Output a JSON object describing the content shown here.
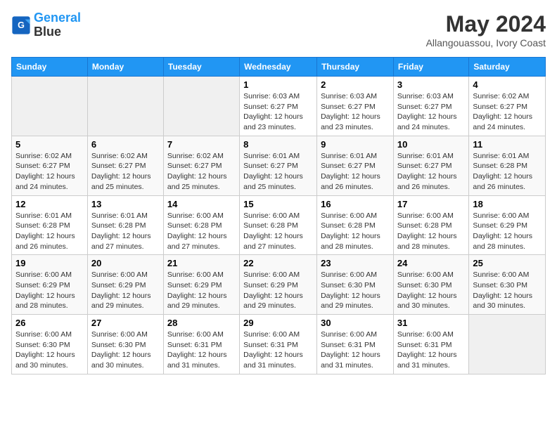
{
  "header": {
    "logo_line1": "General",
    "logo_line2": "Blue",
    "month_year": "May 2024",
    "location": "Allangouassou, Ivory Coast"
  },
  "days_of_week": [
    "Sunday",
    "Monday",
    "Tuesday",
    "Wednesday",
    "Thursday",
    "Friday",
    "Saturday"
  ],
  "weeks": [
    [
      {
        "day": "",
        "info": ""
      },
      {
        "day": "",
        "info": ""
      },
      {
        "day": "",
        "info": ""
      },
      {
        "day": "1",
        "info": "Sunrise: 6:03 AM\nSunset: 6:27 PM\nDaylight: 12 hours\nand 23 minutes."
      },
      {
        "day": "2",
        "info": "Sunrise: 6:03 AM\nSunset: 6:27 PM\nDaylight: 12 hours\nand 23 minutes."
      },
      {
        "day": "3",
        "info": "Sunrise: 6:03 AM\nSunset: 6:27 PM\nDaylight: 12 hours\nand 24 minutes."
      },
      {
        "day": "4",
        "info": "Sunrise: 6:02 AM\nSunset: 6:27 PM\nDaylight: 12 hours\nand 24 minutes."
      }
    ],
    [
      {
        "day": "5",
        "info": "Sunrise: 6:02 AM\nSunset: 6:27 PM\nDaylight: 12 hours\nand 24 minutes."
      },
      {
        "day": "6",
        "info": "Sunrise: 6:02 AM\nSunset: 6:27 PM\nDaylight: 12 hours\nand 25 minutes."
      },
      {
        "day": "7",
        "info": "Sunrise: 6:02 AM\nSunset: 6:27 PM\nDaylight: 12 hours\nand 25 minutes."
      },
      {
        "day": "8",
        "info": "Sunrise: 6:01 AM\nSunset: 6:27 PM\nDaylight: 12 hours\nand 25 minutes."
      },
      {
        "day": "9",
        "info": "Sunrise: 6:01 AM\nSunset: 6:27 PM\nDaylight: 12 hours\nand 26 minutes."
      },
      {
        "day": "10",
        "info": "Sunrise: 6:01 AM\nSunset: 6:27 PM\nDaylight: 12 hours\nand 26 minutes."
      },
      {
        "day": "11",
        "info": "Sunrise: 6:01 AM\nSunset: 6:28 PM\nDaylight: 12 hours\nand 26 minutes."
      }
    ],
    [
      {
        "day": "12",
        "info": "Sunrise: 6:01 AM\nSunset: 6:28 PM\nDaylight: 12 hours\nand 26 minutes."
      },
      {
        "day": "13",
        "info": "Sunrise: 6:01 AM\nSunset: 6:28 PM\nDaylight: 12 hours\nand 27 minutes."
      },
      {
        "day": "14",
        "info": "Sunrise: 6:00 AM\nSunset: 6:28 PM\nDaylight: 12 hours\nand 27 minutes."
      },
      {
        "day": "15",
        "info": "Sunrise: 6:00 AM\nSunset: 6:28 PM\nDaylight: 12 hours\nand 27 minutes."
      },
      {
        "day": "16",
        "info": "Sunrise: 6:00 AM\nSunset: 6:28 PM\nDaylight: 12 hours\nand 28 minutes."
      },
      {
        "day": "17",
        "info": "Sunrise: 6:00 AM\nSunset: 6:28 PM\nDaylight: 12 hours\nand 28 minutes."
      },
      {
        "day": "18",
        "info": "Sunrise: 6:00 AM\nSunset: 6:29 PM\nDaylight: 12 hours\nand 28 minutes."
      }
    ],
    [
      {
        "day": "19",
        "info": "Sunrise: 6:00 AM\nSunset: 6:29 PM\nDaylight: 12 hours\nand 28 minutes."
      },
      {
        "day": "20",
        "info": "Sunrise: 6:00 AM\nSunset: 6:29 PM\nDaylight: 12 hours\nand 29 minutes."
      },
      {
        "day": "21",
        "info": "Sunrise: 6:00 AM\nSunset: 6:29 PM\nDaylight: 12 hours\nand 29 minutes."
      },
      {
        "day": "22",
        "info": "Sunrise: 6:00 AM\nSunset: 6:29 PM\nDaylight: 12 hours\nand 29 minutes."
      },
      {
        "day": "23",
        "info": "Sunrise: 6:00 AM\nSunset: 6:30 PM\nDaylight: 12 hours\nand 29 minutes."
      },
      {
        "day": "24",
        "info": "Sunrise: 6:00 AM\nSunset: 6:30 PM\nDaylight: 12 hours\nand 30 minutes."
      },
      {
        "day": "25",
        "info": "Sunrise: 6:00 AM\nSunset: 6:30 PM\nDaylight: 12 hours\nand 30 minutes."
      }
    ],
    [
      {
        "day": "26",
        "info": "Sunrise: 6:00 AM\nSunset: 6:30 PM\nDaylight: 12 hours\nand 30 minutes."
      },
      {
        "day": "27",
        "info": "Sunrise: 6:00 AM\nSunset: 6:30 PM\nDaylight: 12 hours\nand 30 minutes."
      },
      {
        "day": "28",
        "info": "Sunrise: 6:00 AM\nSunset: 6:31 PM\nDaylight: 12 hours\nand 31 minutes."
      },
      {
        "day": "29",
        "info": "Sunrise: 6:00 AM\nSunset: 6:31 PM\nDaylight: 12 hours\nand 31 minutes."
      },
      {
        "day": "30",
        "info": "Sunrise: 6:00 AM\nSunset: 6:31 PM\nDaylight: 12 hours\nand 31 minutes."
      },
      {
        "day": "31",
        "info": "Sunrise: 6:00 AM\nSunset: 6:31 PM\nDaylight: 12 hours\nand 31 minutes."
      },
      {
        "day": "",
        "info": ""
      }
    ]
  ]
}
